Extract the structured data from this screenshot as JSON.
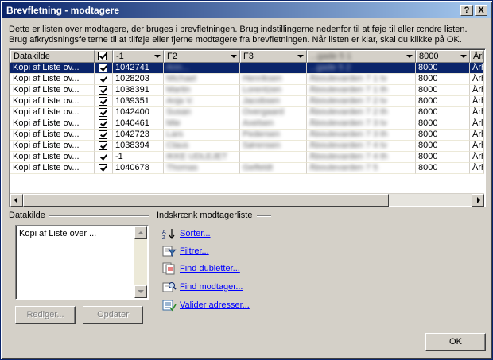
{
  "window": {
    "title": "Brevfletning - modtagere",
    "help_label": "?",
    "close_label": "X"
  },
  "instructions": {
    "line1": "Dette er listen over modtagere, der bruges i brevfletningen. Brug indstillingerne nedenfor til at føje til eller ændre listen.",
    "line2": "Brug afkrydsningsfelterne til at tilføje eller fjerne modtagere fra brevfletningen. Når listen er klar, skal du klikke på OK."
  },
  "grid": {
    "columns": [
      "Datakilde",
      "",
      "-1",
      "F2",
      "F3",
      "...gade 5 1",
      "8000",
      "Århus"
    ],
    "rows": [
      {
        "source": "Kopi af Liste ov...",
        "checked": true,
        "id": "1042741",
        "f2": "Ann...",
        "f3": "",
        "addr": "...gade 5 2",
        "zip": "8000",
        "city": "Århus",
        "selected": true
      },
      {
        "source": "Kopi af Liste ov...",
        "checked": true,
        "id": "1028203",
        "f2": "Michael",
        "f3": "Henriksen",
        "addr": "Åboulevarden 7 1 tv",
        "zip": "8000",
        "city": "Århus",
        "selected": false
      },
      {
        "source": "Kopi af Liste ov...",
        "checked": true,
        "id": "1038391",
        "f2": "Martin",
        "f3": "Lorentzen",
        "addr": "Åboulevarden 7 1 th",
        "zip": "8000",
        "city": "Århus",
        "selected": false
      },
      {
        "source": "Kopi af Liste ov...",
        "checked": true,
        "id": "1039351",
        "f2": "Anja V.",
        "f3": "Jacobsen",
        "addr": "Åboulevarden 7 2 tv",
        "zip": "8000",
        "city": "Århus",
        "selected": false
      },
      {
        "source": "Kopi af Liste ov...",
        "checked": true,
        "id": "1042400",
        "f2": "Susan",
        "f3": "Overgaard",
        "addr": "Åboulevarden 7 2 th",
        "zip": "8000",
        "city": "Århus",
        "selected": false
      },
      {
        "source": "Kopi af Liste ov...",
        "checked": true,
        "id": "1040461",
        "f2": "Mie",
        "f3": "Axelsen",
        "addr": "Åboulevarden 7 3 tv",
        "zip": "8000",
        "city": "Århus",
        "selected": false
      },
      {
        "source": "Kopi af Liste ov...",
        "checked": true,
        "id": "1042723",
        "f2": "Lars",
        "f3": "Pedersen",
        "addr": "Åboulevarden 7 3 th",
        "zip": "8000",
        "city": "Århus",
        "selected": false
      },
      {
        "source": "Kopi af Liste ov...",
        "checked": true,
        "id": "1038394",
        "f2": "Claus",
        "f3": "Sørensen",
        "addr": "Åboulevarden 7 4 tv",
        "zip": "8000",
        "city": "Århus",
        "selected": false
      },
      {
        "source": "Kopi af Liste ov...",
        "checked": true,
        "id": "-1",
        "f2": "IKKE UDLEJET",
        "f3": "",
        "addr": "Åboulevarden 7 4 th",
        "zip": "8000",
        "city": "Århus",
        "selected": false
      },
      {
        "source": "Kopi af Liste ov...",
        "checked": true,
        "id": "1040678",
        "f2": "Thomas",
        "f3": "Gelfeldt",
        "addr": "Åboulevarden 7 5",
        "zip": "8000",
        "city": "Århus",
        "selected": false
      }
    ]
  },
  "datakilde": {
    "label": "Datakilde",
    "item": "Kopi af Liste over ...",
    "edit_button": "Rediger...",
    "update_button": "Opdater"
  },
  "refine": {
    "label": "Indskrænk modtagerliste",
    "links": [
      {
        "label": "Sorter...",
        "icon": "sort-icon"
      },
      {
        "label": "Filtrer...",
        "icon": "filter-icon"
      },
      {
        "label": "Find dubletter...",
        "icon": "duplicates-icon"
      },
      {
        "label": "Find modtager...",
        "icon": "find-recipient-icon"
      },
      {
        "label": "Valider adresser...",
        "icon": "validate-icon"
      }
    ]
  },
  "footer": {
    "ok_label": "OK"
  },
  "colors": {
    "selection": "#0a246a",
    "face": "#d4d0c8",
    "link": "#0000ff"
  }
}
